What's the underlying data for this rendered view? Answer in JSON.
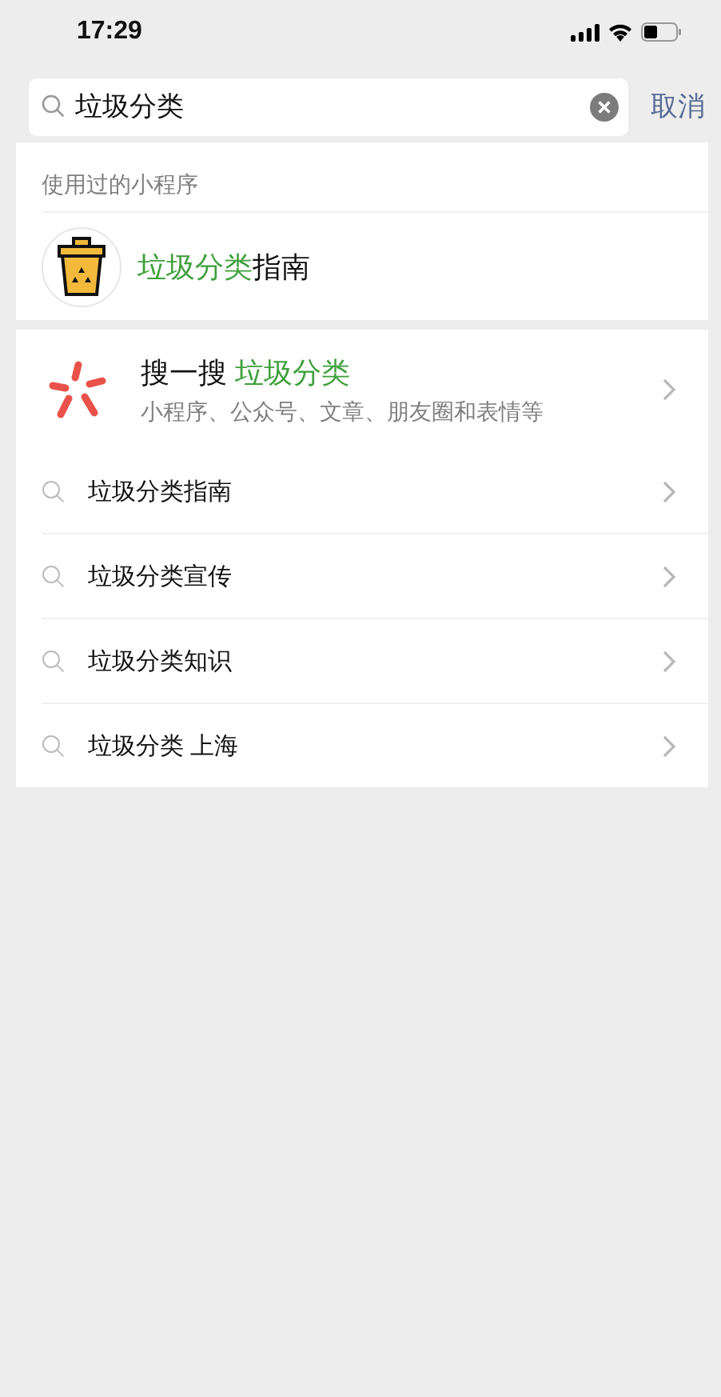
{
  "status_bar": {
    "time": "17:29"
  },
  "search": {
    "value": "垃圾分类",
    "cancel": "取消"
  },
  "mini_programs": {
    "header": "使用过的小程序",
    "items": [
      {
        "name_parts": [
          {
            "text": "垃圾分类",
            "highlight": true
          },
          {
            "text": "指南",
            "highlight": false
          }
        ]
      }
    ]
  },
  "sou_yi_sou": {
    "title_parts": [
      {
        "text": "搜一搜 ",
        "highlight": false
      },
      {
        "text": "垃圾分类",
        "highlight": true
      }
    ],
    "subtitle": "小程序、公众号、文章、朋友圈和表情等"
  },
  "suggestions": [
    {
      "text": "垃圾分类指南"
    },
    {
      "text": "垃圾分类宣传"
    },
    {
      "text": "垃圾分类知识"
    },
    {
      "text": "垃圾分类 上海"
    }
  ]
}
